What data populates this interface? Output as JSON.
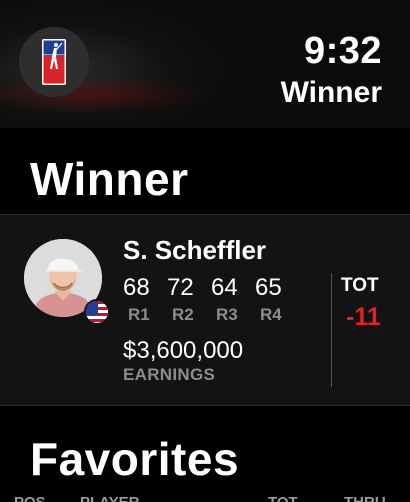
{
  "status": {
    "time": "9:32"
  },
  "nav": {
    "title": "Winner"
  },
  "sections": {
    "winner": "Winner",
    "favorites": "Favorites"
  },
  "winner": {
    "name": "S. Scheffler",
    "rounds": [
      {
        "score": "68",
        "label": "R1"
      },
      {
        "score": "72",
        "label": "R2"
      },
      {
        "score": "64",
        "label": "R3"
      },
      {
        "score": "65",
        "label": "R4"
      }
    ],
    "earnings": "$3,600,000",
    "earnings_label": "EARNINGS",
    "total_label": "TOT",
    "total_value": "-11",
    "flag": "us-flag-icon"
  },
  "favorites_headers": [
    "POS",
    "PLAYER",
    "TOT",
    "THRU"
  ],
  "colors": {
    "accent_red": "#e02222",
    "card_bg": "#131313",
    "muted_text": "#8c8c8c"
  }
}
